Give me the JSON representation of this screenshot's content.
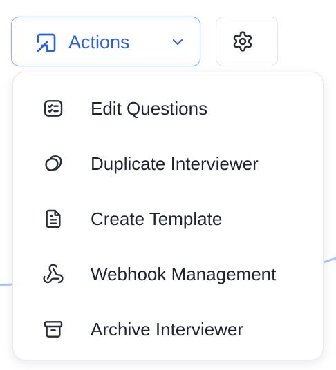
{
  "toolbar": {
    "actions_label": "Actions",
    "actions_icon": "square-arrow-up-left-icon",
    "dropdown_icon": "chevron-down-icon",
    "settings_icon": "gear-icon"
  },
  "menu": {
    "items": [
      {
        "label": "Edit Questions",
        "icon": "checklist-icon"
      },
      {
        "label": "Duplicate Interviewer",
        "icon": "duplicate-icon"
      },
      {
        "label": "Create Template",
        "icon": "document-icon"
      },
      {
        "label": "Webhook Management",
        "icon": "webhook-icon"
      },
      {
        "label": "Archive Interviewer",
        "icon": "archive-icon"
      }
    ]
  },
  "colors": {
    "accent": "#2f5fd8",
    "accent_border": "#8ab0ff",
    "text": "#1f2330",
    "icon": "#2a2d36"
  }
}
